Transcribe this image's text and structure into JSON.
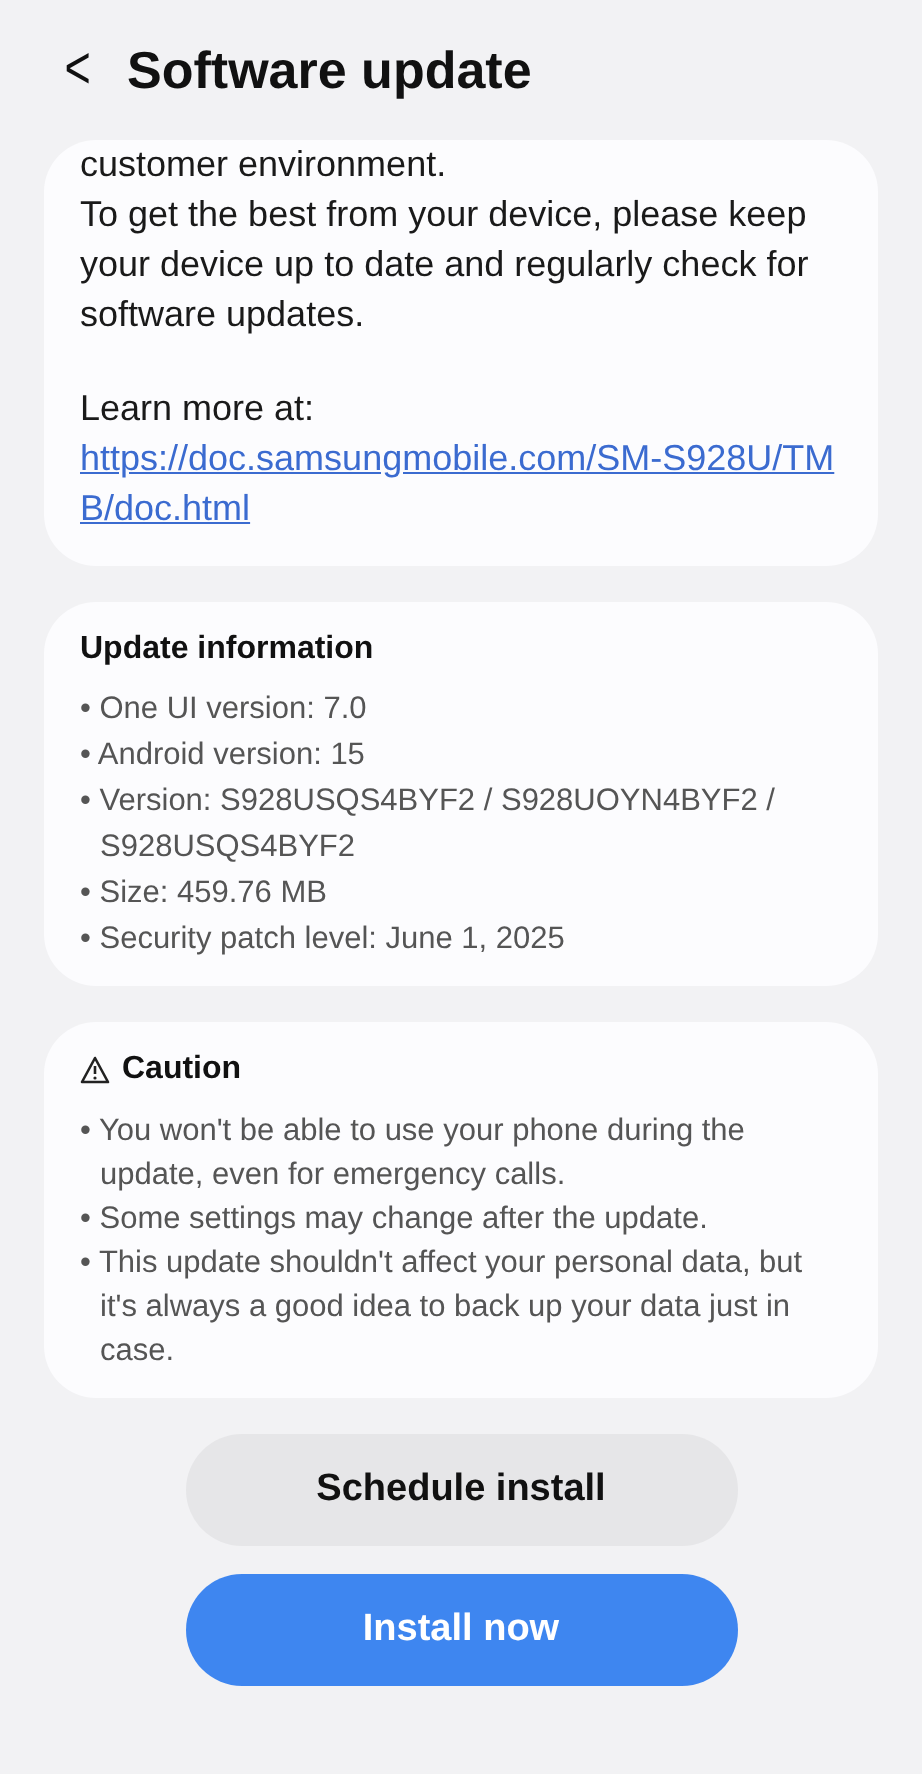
{
  "header": {
    "back": "<",
    "title": "Software update"
  },
  "notes": {
    "paragraphs": [
      "customer environment.\nTo get the best from your device, please keep your device up to date and regularly check for software updates.",
      "Learn more at:"
    ],
    "link": "https://doc.samsungmobile.com/SM-S928U/TMB/doc.html"
  },
  "update_information": {
    "title": "Update information",
    "items": [
      "• One UI version: 7.0",
      "• Android version: 15",
      "• Version: S928USQS4BYF2 / S928UOYN4BYF2 / S928USQS4BYF2",
      "• Size: 459.76 MB",
      "• Security patch level: June 1, 2025"
    ]
  },
  "caution": {
    "title": "Caution",
    "items": [
      "• You won't be able to use your phone during the update, even for emergency calls.",
      "• Some settings may change after the update.",
      "• This update shouldn't affect your personal data, but it's always a good idea to back up your data just in case."
    ]
  },
  "buttons": [
    {
      "label": "Schedule install",
      "kind": "secondary"
    },
    {
      "label": "Install now",
      "kind": "primary"
    }
  ]
}
